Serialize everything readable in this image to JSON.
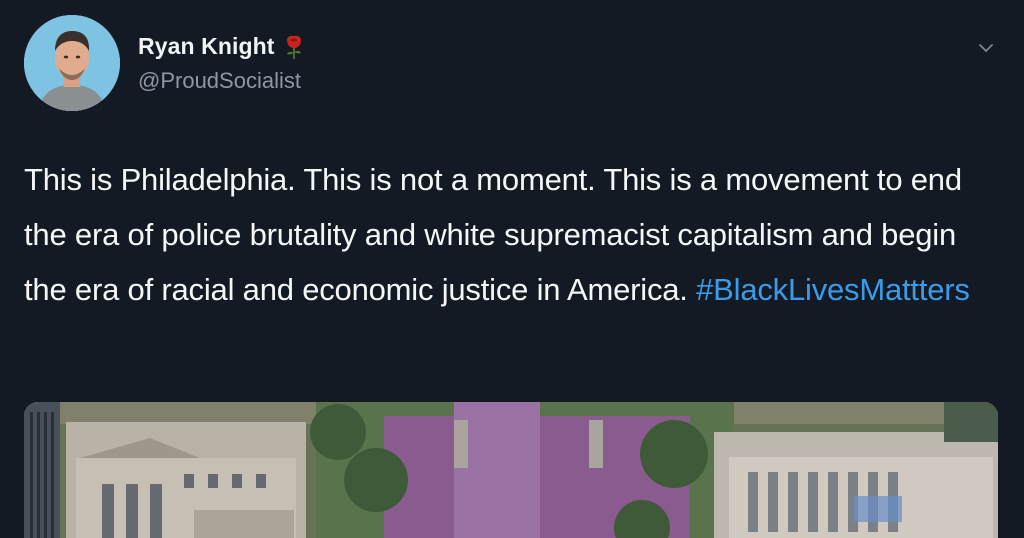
{
  "tweet": {
    "author": {
      "display_name": "Ryan Knight",
      "handle": "@ProudSocialist",
      "emoji_icon": "rose-icon",
      "avatar_icon": "profile-avatar"
    },
    "menu_icon": "chevron-down-icon",
    "text_body": "This is Philadelphia. This is not a moment. This is a movement to end the era of police brutality and white supremacist capitalism and begin the era of racial and economic justice in America. ",
    "hashtag": "#BlackLivesMattters",
    "media": {
      "icon": "aerial-crowd-photo"
    },
    "colors": {
      "background": "#141a23",
      "text": "#f5f6f7",
      "secondary": "#8b98a5",
      "link": "#3b9be8"
    }
  }
}
